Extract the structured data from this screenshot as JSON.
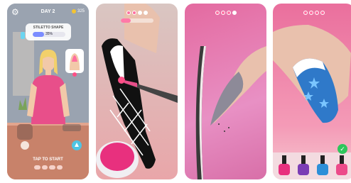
{
  "screens": [
    {
      "header": {
        "day_label": "DAY 2",
        "coin_count": "325"
      },
      "shape_panel": {
        "title": "STILETTO SHAPE",
        "progress_text": "35%",
        "progress_value": 35
      },
      "cta": {
        "label": "TAP TO START"
      }
    },
    {
      "step_dots": [
        "#ff6fa0",
        "#ff6fa0",
        "#ffffff",
        "#ffffff"
      ],
      "progress_value": 30
    },
    {
      "step_dots": [
        "#ff6fa0",
        "#ff6fa0",
        "#ff6fa0",
        "#ffffff"
      ],
      "progress_value": 0
    },
    {
      "step_dots": [
        "#ff6fa0",
        "#ff6fa0",
        "#ff6fa0",
        "#ff6fa0"
      ],
      "progress_value": 0
    }
  ],
  "colors": {
    "accent_pink": "#ff6fa0",
    "nail_blue": "#2f79c9",
    "polish_colors": [
      "#e8307e",
      "#7b3db5",
      "#2d8fd8",
      "#ec4b8a"
    ]
  }
}
